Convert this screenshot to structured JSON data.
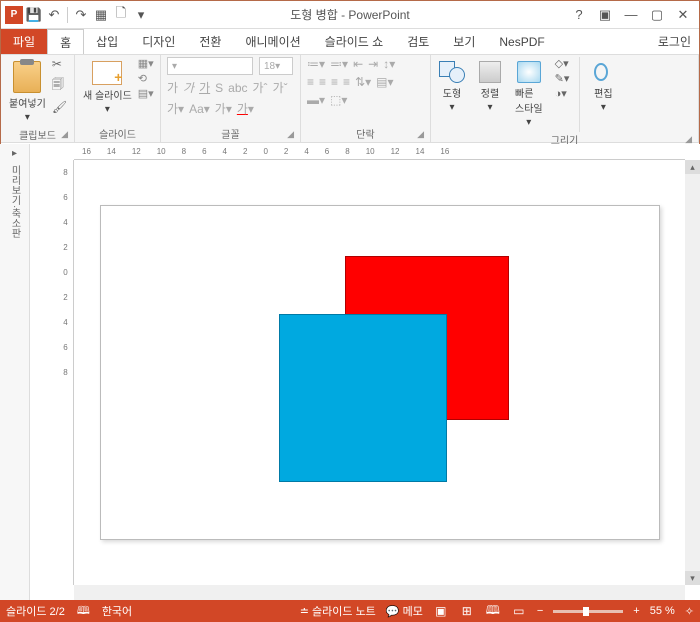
{
  "title": "도형 병합 - PowerPoint",
  "qat": {
    "save": "💾",
    "undo": "↶",
    "redo": "↷",
    "start": "▦",
    "new": "🗋"
  },
  "win": {
    "help": "?",
    "ribbon": "▣",
    "min": "—",
    "max": "▢",
    "close": "✕"
  },
  "tabs": {
    "file": "파일",
    "home": "홈",
    "insert": "삽입",
    "design": "디자인",
    "transition": "전환",
    "anim": "애니메이션",
    "slideshow": "슬라이드 쇼",
    "review": "검토",
    "view": "보기",
    "nespdf": "NesPDF",
    "login": "로그인"
  },
  "ribbon": {
    "clipboard": {
      "label": "클립보드",
      "paste": "붙여넣기"
    },
    "slides": {
      "label": "슬라이드",
      "new": "새 슬라이드"
    },
    "font": {
      "label": "글꼴",
      "size": "18"
    },
    "para": {
      "label": "단락"
    },
    "draw": {
      "label": "그리기",
      "shapes": "도형",
      "arrange": "정렬",
      "quick": "빠른\n스타일",
      "edit": "편집"
    }
  },
  "ruler_h": [
    "16",
    "14",
    "12",
    "10",
    "8",
    "6",
    "4",
    "2",
    "0",
    "2",
    "4",
    "6",
    "8",
    "10",
    "12",
    "14",
    "16"
  ],
  "ruler_v": [
    "8",
    "6",
    "4",
    "2",
    "0",
    "2",
    "4",
    "6",
    "8"
  ],
  "side_panel": {
    "toggle": "▸",
    "text": "미리보기·축소판"
  },
  "status": {
    "slide": "슬라이드 2/2",
    "lang": "한국어",
    "notes": "슬라이드 노트",
    "comments": "메모",
    "zoom": "55 %",
    "fit": "✧"
  }
}
